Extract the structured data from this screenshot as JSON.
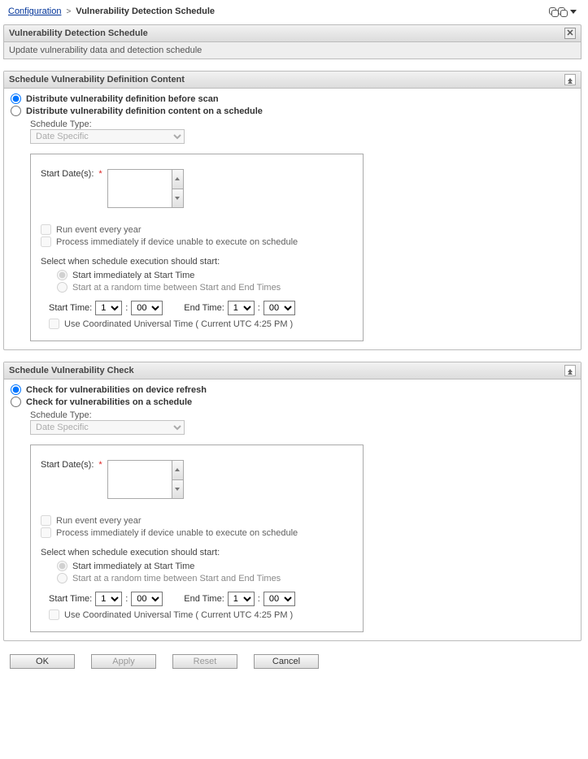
{
  "breadcrumb": {
    "link": "Configuration",
    "sep": ">",
    "current": "Vulnerability Detection Schedule"
  },
  "titleBar": {
    "title": "Vulnerability Detection Schedule",
    "close": "✕"
  },
  "subBar": {
    "text": "Update vulnerability data and detection schedule"
  },
  "panel1": {
    "header": "Schedule Vulnerability Definition Content",
    "opt1": "Distribute vulnerability definition before scan",
    "opt2": "Distribute vulnerability definition content on a schedule",
    "scheduleTypeLabel": "Schedule Type:",
    "scheduleTypeValue": "Date Specific",
    "startDatesLabel": "Start Date(s):",
    "req": "*",
    "runEveryYear": "Run event every year",
    "processImmediately": "Process immediately if device unable to execute on schedule",
    "execHead": "Select when schedule execution should start:",
    "execOpt1": "Start immediately at Start Time",
    "execOpt2": "Start at a random time between Start and End Times",
    "startTimeLabel": "Start Time:",
    "startHour": "1",
    "colon": ":",
    "startMin": "00",
    "endTimeLabel": "End Time:",
    "endHour": "1",
    "endMin": "00",
    "utcLabel": "Use Coordinated Universal Time ( Current UTC 4:25 PM )"
  },
  "panel2": {
    "header": "Schedule Vulnerability Check",
    "opt1": "Check for vulnerabilities on device refresh",
    "opt2": "Check for vulnerabilities on a schedule",
    "scheduleTypeLabel": "Schedule Type:",
    "scheduleTypeValue": "Date Specific",
    "startDatesLabel": "Start Date(s):",
    "req": "*",
    "runEveryYear": "Run event every year",
    "processImmediately": "Process immediately if device unable to execute on schedule",
    "execHead": "Select when schedule execution should start:",
    "execOpt1": "Start immediately at Start Time",
    "execOpt2": "Start at a random time between Start and End Times",
    "startTimeLabel": "Start Time:",
    "startHour": "1",
    "colon": ":",
    "startMin": "00",
    "endTimeLabel": "End Time:",
    "endHour": "1",
    "endMin": "00",
    "utcLabel": "Use Coordinated Universal Time ( Current UTC 4:25 PM )"
  },
  "buttons": {
    "ok": "OK",
    "apply": "Apply",
    "reset": "Reset",
    "cancel": "Cancel"
  }
}
